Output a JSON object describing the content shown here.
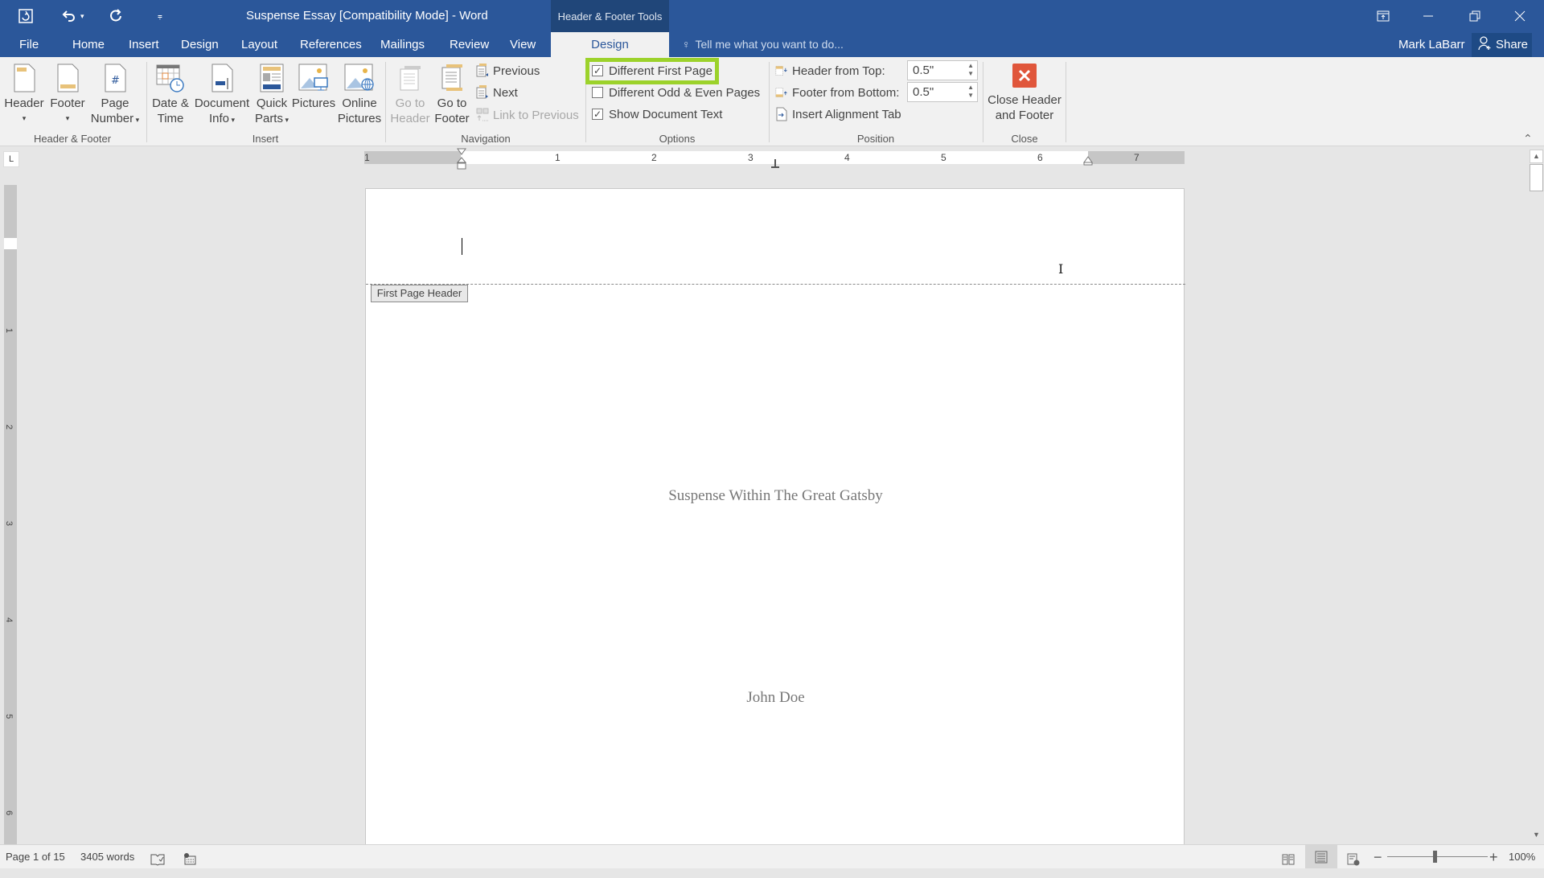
{
  "window": {
    "title": "Suspense Essay [Compatibility Mode] - Word",
    "context_group": "Header & Footer Tools",
    "controls": {
      "ribbon_display": "ribbon-display-options-icon",
      "minimize": "minimize-icon",
      "restore": "restore-icon",
      "close": "close-icon"
    }
  },
  "quick_access": {
    "save": "save-icon",
    "undo": "undo-icon",
    "redo": "redo-icon",
    "customize": "customize-qat-icon"
  },
  "tabs": [
    {
      "label": "File"
    },
    {
      "label": "Home"
    },
    {
      "label": "Insert"
    },
    {
      "label": "Design"
    },
    {
      "label": "Layout"
    },
    {
      "label": "References"
    },
    {
      "label": "Mailings"
    },
    {
      "label": "Review"
    },
    {
      "label": "View"
    },
    {
      "label": "Design",
      "active": true
    }
  ],
  "tell_me": {
    "placeholder": "Tell me what you want to do..."
  },
  "user": {
    "name": "Mark LaBarr",
    "share_label": "Share"
  },
  "ribbon": {
    "groups": {
      "header_footer": {
        "label": "Header & Footer",
        "header": "Header",
        "footer": "Footer",
        "page_number_1": "Page",
        "page_number_2": "Number"
      },
      "insert": {
        "label": "Insert",
        "date_time_1": "Date &",
        "date_time_2": "Time",
        "doc_info_1": "Document",
        "doc_info_2": "Info",
        "quick_parts_1": "Quick",
        "quick_parts_2": "Parts",
        "pictures": "Pictures",
        "online_pictures_1": "Online",
        "online_pictures_2": "Pictures"
      },
      "navigation": {
        "label": "Navigation",
        "go_to_header_1": "Go to",
        "go_to_header_2": "Header",
        "go_to_footer_1": "Go to",
        "go_to_footer_2": "Footer",
        "previous": "Previous",
        "next": "Next",
        "link_to_previous": "Link to Previous"
      },
      "options": {
        "label": "Options",
        "different_first_page": {
          "label": "Different First Page",
          "checked": true
        },
        "different_odd_even": {
          "label": "Different Odd & Even Pages",
          "checked": false
        },
        "show_document_text": {
          "label": "Show Document Text",
          "checked": true
        }
      },
      "position": {
        "label": "Position",
        "header_from_top_label": "Header from Top:",
        "header_from_top_value": "0.5\"",
        "footer_from_bottom_label": "Footer from Bottom:",
        "footer_from_bottom_value": "0.5\"",
        "insert_alignment_tab": "Insert Alignment Tab"
      },
      "close": {
        "label": "Close",
        "close_1": "Close Header",
        "close_2": "and Footer"
      }
    },
    "highlight_color": "#9cd22b"
  },
  "ruler": {
    "horizontal_numbers": [
      "1",
      "1",
      "2",
      "3",
      "4",
      "5",
      "6",
      "7"
    ],
    "vertical_numbers": [
      "1",
      "2",
      "3",
      "4",
      "5",
      "6"
    ],
    "tab_selector": "L"
  },
  "document": {
    "header_tag": "First Page Header",
    "title": "Suspense Within The Great Gatsby",
    "author": "John Doe"
  },
  "status": {
    "page": "Page 1 of 15",
    "words": "3405 words",
    "proofing_icon": "proofing-icon",
    "macro_icon": "macro-recording-icon",
    "zoom_level": "100%",
    "zoom_percent": 100
  },
  "colors": {
    "brand": "#2b579a",
    "close_red": "#e0563b"
  }
}
